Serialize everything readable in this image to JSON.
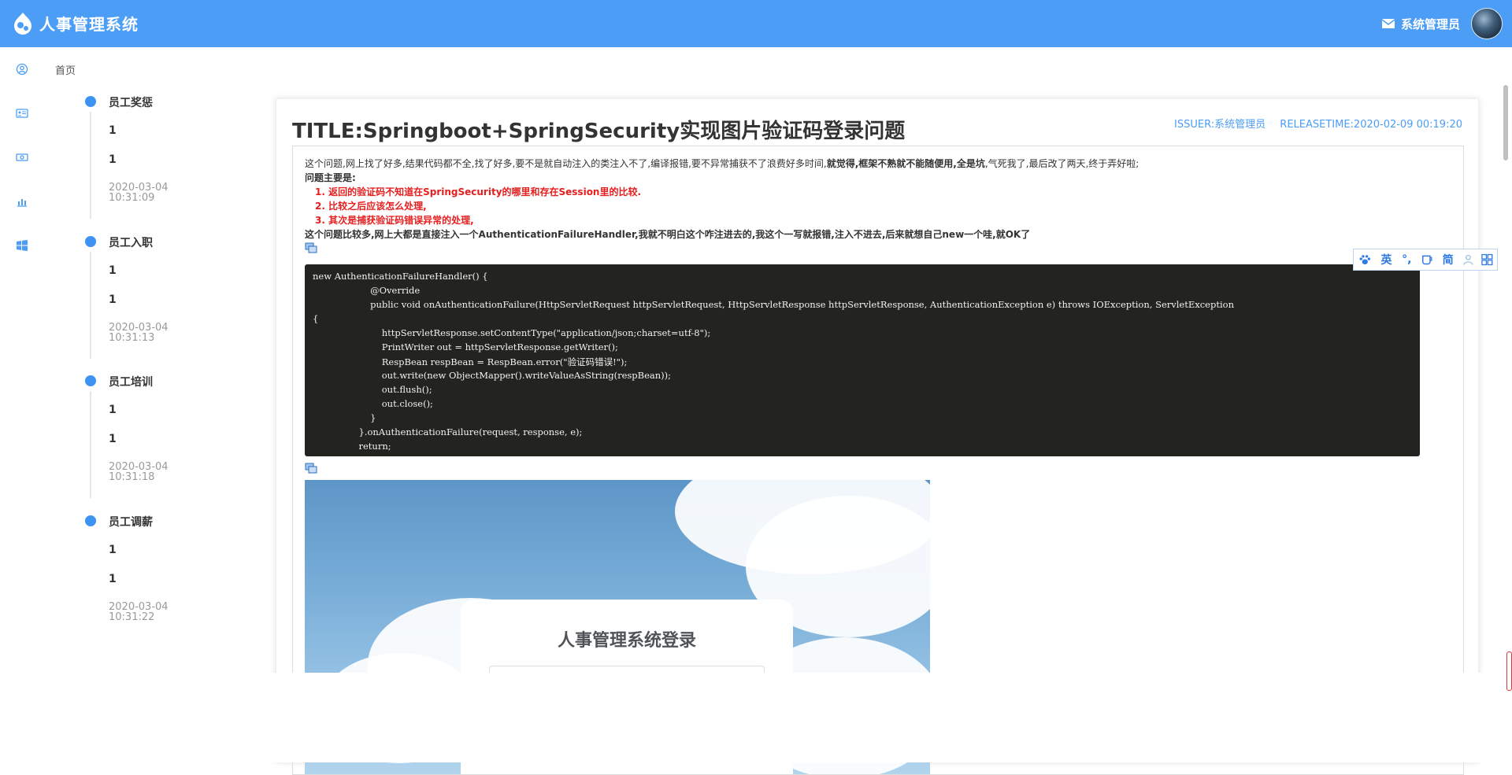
{
  "header": {
    "app_title": "人事管理系统",
    "user_name": "系统管理员"
  },
  "breadcrumb": "首页",
  "timeline": [
    {
      "title": "员工奖惩",
      "val1": "1",
      "val2": "1",
      "date": "2020-03-04",
      "time": "10:31:09"
    },
    {
      "title": "员工入职",
      "val1": "1",
      "val2": "1",
      "date": "2020-03-04",
      "time": "10:31:13"
    },
    {
      "title": "员工培训",
      "val1": "1",
      "val2": "1",
      "date": "2020-03-04",
      "time": "10:31:18"
    },
    {
      "title": "员工调薪",
      "val1": "1",
      "val2": "1",
      "date": "2020-03-04",
      "time": "10:31:22"
    }
  ],
  "article": {
    "title": "TITLE:Springboot+SpringSecurity实现图片验证码登录问题",
    "issuer": "ISSUER:系统管理员",
    "release_time": "RELEASETIME:2020-02-09 00:19:20",
    "intro_normal_1": "这个问题,网上找了好多,结果代码都不全,找了好多,要不是就自动注入的类注入不了,编译报错,要不异常捕获不了浪费好多时间,",
    "intro_bold": "就觉得,框架不熟就不能随便用,全是坑",
    "intro_normal_2": ",气死我了,最后改了两天,终于弄好啦;",
    "main_problem": "问题主要是:",
    "points": [
      "1. 返回的验证码不知道在SpringSecurity的哪里和存在Session里的比较.",
      "2. 比较之后应该怎么处理,",
      "3. 其次是捕获验证码错误异常的处理,"
    ],
    "summary": "这个问题比较多,网上大都是直接注入一个AuthenticationFailureHandler,我就不明白这个咋注进去的,我这个一写就报错,注入不进去,后来就想自己new一个哇,就OK了",
    "code_lines": [
      "new AuthenticationFailureHandler() {",
      "                    @Override",
      "                    public void onAuthenticationFailure(HttpServletRequest httpServletRequest, HttpServletResponse httpServletResponse, AuthenticationException e) throws IOException, ServletException",
      "{",
      "                        httpServletResponse.setContentType(\"application/json;charset=utf-8\");",
      "                        PrintWriter out = httpServletResponse.getWriter();",
      "                        RespBean respBean = RespBean.error(\"验证码错误!\");",
      "                        out.write(new ObjectMapper().writeValueAsString(respBean));",
      "                        out.flush();",
      "                        out.close();",
      "                    }",
      "                }.onAuthenticationFailure(request, response, e);",
      "                return;"
    ],
    "login_card_title": "人事管理系统登录"
  },
  "ime": {
    "items": [
      "英",
      "°,",
      "简"
    ]
  },
  "colors": {
    "header_bg": "#4b9df6",
    "accent": "#3d93f1",
    "highlight_red": "#e61e1e",
    "code_bg": "#23241f"
  }
}
